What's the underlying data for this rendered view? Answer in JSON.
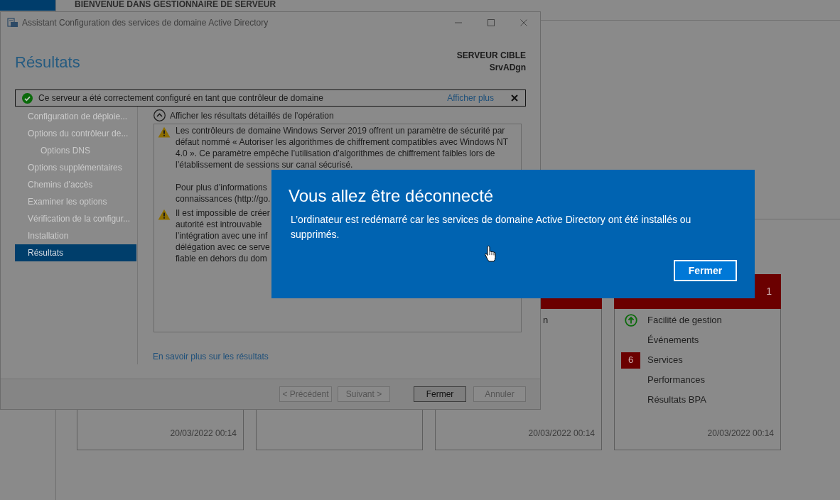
{
  "server_manager": {
    "header": "BIENVENUE DANS GESTIONNAIRE DE SERVEUR",
    "tiles": [
      {
        "kind": "group",
        "date": "20/03/2022 00:14"
      },
      {
        "kind": "group"
      },
      {
        "kind": "group",
        "alert": true,
        "rows": [
          {
            "kind": "fragment",
            "label": "n"
          }
        ],
        "date": "20/03/2022 00:14"
      },
      {
        "kind": "group",
        "alert": true,
        "count": "1",
        "rows": [
          {
            "kind": "ok",
            "label": "Facilité de gestion"
          },
          {
            "kind": "plain",
            "label": "Événements"
          },
          {
            "kind": "count",
            "count": "6",
            "label": "Services"
          },
          {
            "kind": "plain",
            "label": "Performances"
          },
          {
            "kind": "plain",
            "label": "Résultats BPA"
          }
        ],
        "date": "20/03/2022 00:14"
      }
    ]
  },
  "wizard": {
    "title": "Assistant Configuration des services de domaine Active Directory",
    "page_title": "Résultats",
    "target_label": "SERVEUR CIBLE",
    "target_server": "SrvADgn",
    "banner": {
      "kind": "success",
      "text": "Ce serveur a été correctement configuré en tant que contrôleur de domaine",
      "link": "Afficher plus"
    },
    "steps": [
      {
        "label": "Configuration de déploie...",
        "selected": false
      },
      {
        "label": "Options du contrôleur de...",
        "selected": false,
        "children": [
          {
            "label": "Options DNS",
            "selected": false
          }
        ]
      },
      {
        "label": "Options supplémentaires",
        "selected": false
      },
      {
        "label": "Chemins d’accès",
        "selected": false
      },
      {
        "label": "Examiner les options",
        "selected": false
      },
      {
        "label": "Vérification de la configur...",
        "selected": false
      },
      {
        "label": "Installation",
        "selected": false
      },
      {
        "label": "Résultats",
        "selected": true
      }
    ],
    "details_toggle": {
      "label": "Afficher les résultats détaillés de l’opération",
      "expanded": true
    },
    "messages": [
      {
        "kind": "warning",
        "paragraph": "Les contrôleurs de domaine Windows Server 2019 offrent un paramètre de sécurité par défaut nommé « Autoriser les algorithmes de chiffrement compatibles avec Windows NT 4.0 ». Ce paramètre empêche l’utilisation d’algorithmes de chiffrement faibles lors de l’établissement de sessions sur canal sécurisé.",
        "lines": [
          "Pour plus d’informations",
          "connaissances (http://go."
        ]
      },
      {
        "kind": "warning",
        "lines": [
          "Il est impossible de créer",
          "autorité est introuvable",
          "l’intégration avec une inf",
          "délégation avec ce serve",
          "fiable en dehors du dom"
        ]
      }
    ],
    "learn_more": "En savoir plus sur les résultats",
    "nav_buttons": [
      {
        "label": "< Précédent",
        "disabled": true
      },
      {
        "label": "Suivant >",
        "disabled": true
      }
    ],
    "action_buttons": [
      {
        "label": "Fermer",
        "disabled": false
      },
      {
        "label": "Annuler",
        "disabled": true
      }
    ]
  },
  "dialog": {
    "title": "Vous allez être déconnecté",
    "message": "L’ordinateur est redémarré car les services de domaine Active Directory ont été installés ou supprimés.",
    "button": "Fermer"
  }
}
